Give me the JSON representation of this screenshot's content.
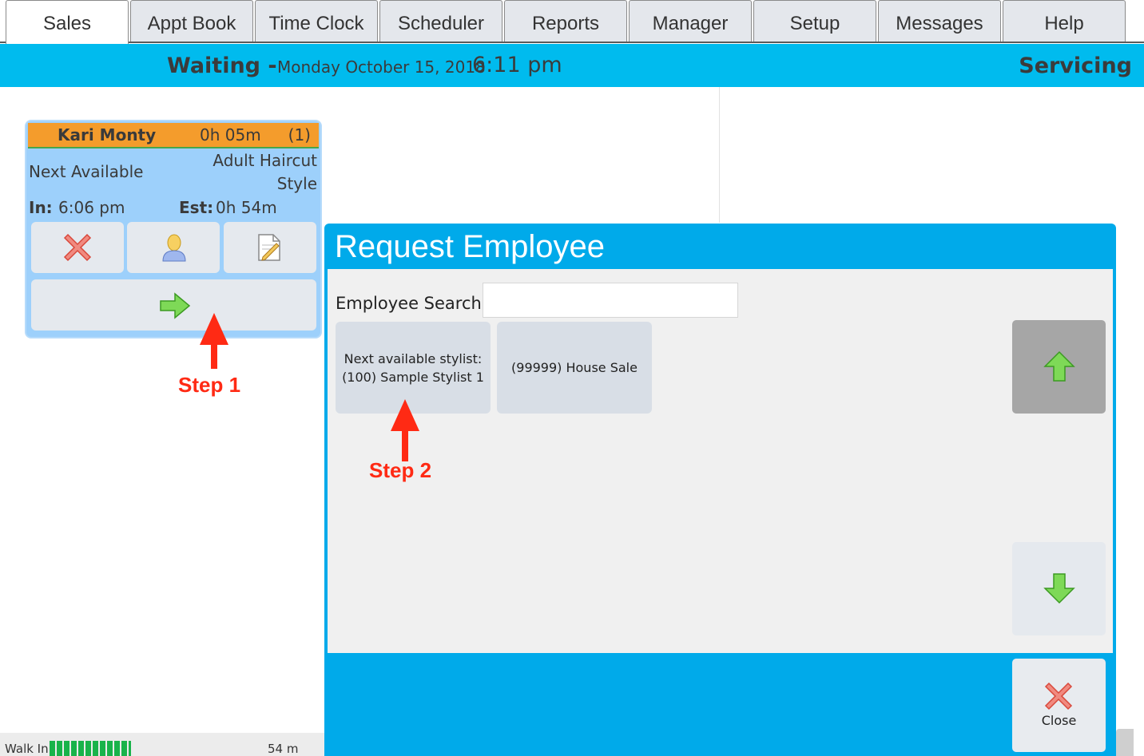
{
  "tabs": [
    {
      "label": "Sales",
      "active": true
    },
    {
      "label": "Appt Book"
    },
    {
      "label": "Time Clock"
    },
    {
      "label": "Scheduler"
    },
    {
      "label": "Reports"
    },
    {
      "label": "Manager"
    },
    {
      "label": "Setup"
    },
    {
      "label": "Messages"
    },
    {
      "label": "Help"
    }
  ],
  "header": {
    "waiting": "Waiting -",
    "date": "Monday October 15, 2018",
    "time": "6:11 pm",
    "servicing": "Servicing"
  },
  "ticket": {
    "name": "Kari Monty",
    "elapsed": "0h 05m",
    "count": "(1)",
    "stylist": "Next Available",
    "service_line1": "Adult Haircut",
    "service_line2": "Style",
    "in_label": "In:",
    "in_time": "6:06 pm",
    "est_label": "Est:",
    "est_time": "0h 54m",
    "header_color": "#f49c2c",
    "card_color": "#9dd0fb"
  },
  "dialog": {
    "title": "Request Employee",
    "search_label": "Employee Search:",
    "search_value": "",
    "employees": [
      {
        "line1": "Next available stylist:",
        "line2": "(100) Sample Stylist 1"
      },
      {
        "line1": "(99999) House Sale"
      }
    ],
    "close_label": "Close",
    "accent_color": "#00aaea"
  },
  "status_bar": {
    "label": "Walk In",
    "minutes": "54 m",
    "progress_segments": 10,
    "color": "#19b34a"
  },
  "annotations": {
    "step1": "Step 1",
    "step2": "Step 2"
  },
  "icons": [
    "delete-x-icon",
    "person-icon",
    "notes-icon",
    "forward-arrow-icon",
    "scroll-up-arrow-icon",
    "scroll-down-arrow-icon",
    "close-x-icon"
  ]
}
